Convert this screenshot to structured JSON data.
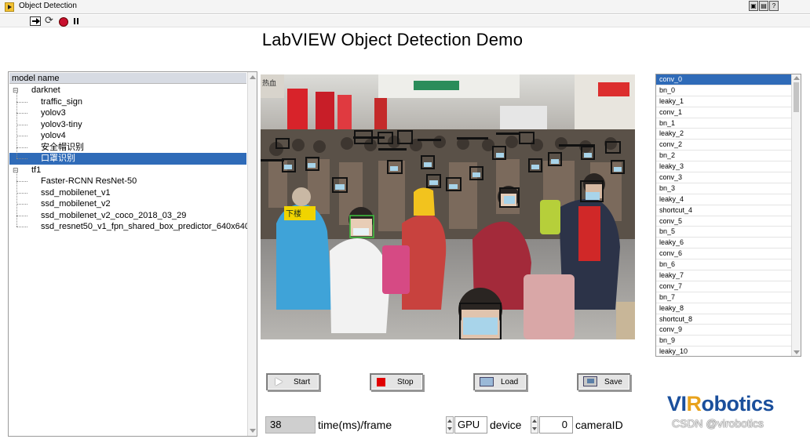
{
  "window": {
    "title": "Object Detection",
    "icons": [
      "vi-icon",
      "help-icon"
    ]
  },
  "toolbar": {
    "buttons": [
      "run-arrow-icon",
      "run-continuously-icon",
      "abort-icon",
      "pause-icon"
    ]
  },
  "page_title": "LabVIEW Object Detection Demo",
  "tree": {
    "header": "model name",
    "groups": [
      {
        "label": "darknet",
        "children": [
          "traffic_sign",
          "yolov3",
          "yolov3-tiny",
          "yolov4",
          "安全帽识别",
          "口罩识别"
        ]
      },
      {
        "label": "tf1",
        "children": [
          "Faster-RCNN ResNet-50",
          "ssd_mobilenet_v1",
          "ssd_mobilenet_v2",
          "ssd_mobilenet_v2_coco_2018_03_29",
          "ssd_resnet50_v1_fpn_shared_box_predictor_640x640"
        ]
      }
    ],
    "selected": "口罩识别"
  },
  "image_display": {
    "signs": [
      "下楼",
      "热血"
    ]
  },
  "layers": {
    "items": [
      "conv_0",
      "bn_0",
      "leaky_1",
      "conv_1",
      "bn_1",
      "leaky_2",
      "conv_2",
      "bn_2",
      "leaky_3",
      "conv_3",
      "bn_3",
      "leaky_4",
      "shortcut_4",
      "conv_5",
      "bn_5",
      "leaky_6",
      "conv_6",
      "bn_6",
      "leaky_7",
      "conv_7",
      "bn_7",
      "leaky_8",
      "shortcut_8",
      "conv_9",
      "bn_9",
      "leaky_10"
    ],
    "selected": "conv_0"
  },
  "buttons": {
    "start": "Start",
    "stop": "Stop",
    "load": "Load",
    "save": "Save"
  },
  "status": {
    "time_value": "38",
    "time_label": "time(ms)/frame",
    "device_value": "GPU",
    "device_label": "device",
    "camera_value": "0",
    "camera_label": "cameraID"
  },
  "logo": {
    "part1": "VI",
    "part2": "R",
    "part3": "obotics"
  },
  "watermark": "CSDN @virobotics",
  "colors": {
    "selection": "#2f6bb8",
    "stop_red": "#e00000",
    "logo_blue": "#1a4f9c",
    "logo_orange": "#e8a21c",
    "box_black": "#111111",
    "box_green": "#3ec43e"
  }
}
